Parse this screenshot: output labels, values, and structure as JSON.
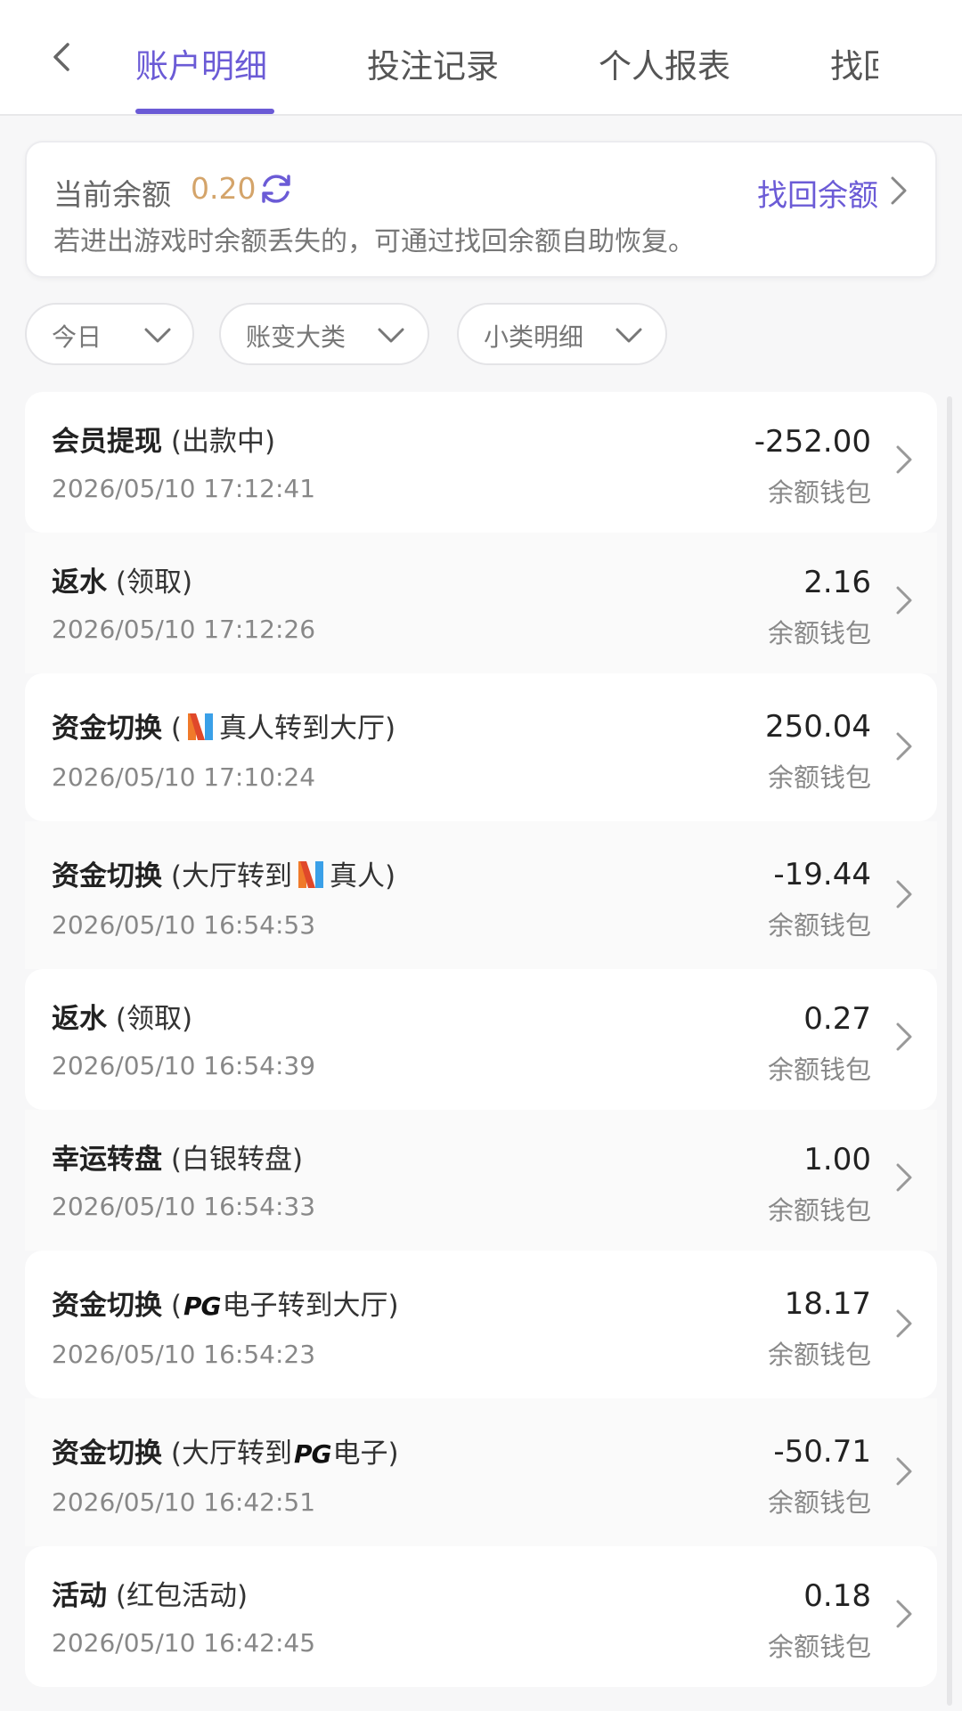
{
  "tabs": [
    "账户明细",
    "投注记录",
    "个人报表",
    "找回"
  ],
  "balance": {
    "label": "当前余额",
    "value": "0.20",
    "recover_label": "找回余额",
    "hint": "若进出游戏时余额丢失的，可通过找回余额自助恢复。"
  },
  "filters": [
    "今日",
    "账变大类",
    "小类明细"
  ],
  "records": [
    {
      "type": "会员提现",
      "open": " (",
      "p1": "出款中",
      "p2": "",
      "close": ")",
      "time": "2026/05/10 17:12:41",
      "amount": "-252.00",
      "wallet": "余额钱包"
    },
    {
      "type": "返水",
      "open": " (",
      "p1": "领取",
      "p2": "",
      "close": ")",
      "time": "2026/05/10 17:12:26",
      "amount": "2.16",
      "wallet": "余额钱包"
    },
    {
      "type": "资金切换",
      "open": " (",
      "p1": "",
      "p2": "真人转到大厅",
      "close": ")",
      "time": "2026/05/10 17:10:24",
      "amount": "250.04",
      "wallet": "余额钱包"
    },
    {
      "type": "资金切换",
      "open": " (",
      "p1": "大厅转到",
      "p2": "真人",
      "close": ")",
      "time": "2026/05/10 16:54:53",
      "amount": "-19.44",
      "wallet": "余额钱包"
    },
    {
      "type": "返水",
      "open": " (",
      "p1": "领取",
      "p2": "",
      "close": ")",
      "time": "2026/05/10 16:54:39",
      "amount": "0.27",
      "wallet": "余额钱包"
    },
    {
      "type": "幸运转盘",
      "open": " (",
      "p1": "白银转盘",
      "p2": "",
      "close": ")",
      "time": "2026/05/10 16:54:33",
      "amount": "1.00",
      "wallet": "余额钱包"
    },
    {
      "type": "资金切换",
      "open": " (",
      "p1": "",
      "pg": "PG",
      "p2": "电子转到大厅",
      "close": ")",
      "time": "2026/05/10 16:54:23",
      "amount": "18.17",
      "wallet": "余额钱包"
    },
    {
      "type": "资金切换",
      "open": " (",
      "p1": "大厅转到",
      "pg": "PG",
      "p2": "电子",
      "close": ")",
      "time": "2026/05/10 16:42:51",
      "amount": "-50.71",
      "wallet": "余额钱包"
    },
    {
      "type": "活动",
      "open": " (",
      "p1": "红包活动",
      "p2": "",
      "close": ")",
      "time": "2026/05/10 16:42:45",
      "amount": "0.18",
      "wallet": "余额钱包"
    }
  ]
}
